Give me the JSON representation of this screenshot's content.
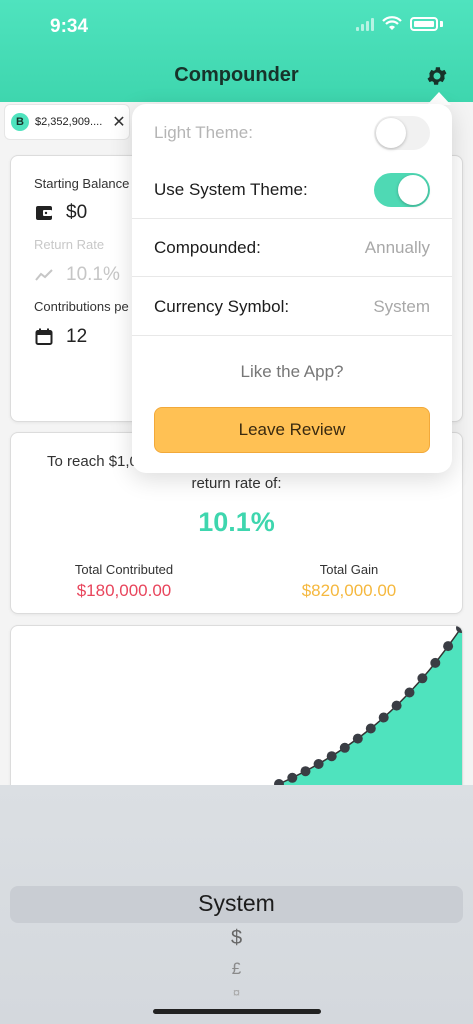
{
  "status_bar": {
    "time": "9:34"
  },
  "header": {
    "title": "Compounder"
  },
  "tabs": [
    {
      "badge": "B",
      "label": "$2,352,909...."
    }
  ],
  "calculator": {
    "starting_balance_label": "Starting Balance",
    "starting_balance_value": "$0",
    "return_rate_label": "Return Rate",
    "return_rate_value": "10.1%",
    "contributions_label": "Contributions pe",
    "contributions_value": "12"
  },
  "result": {
    "reach_text": "To reach $1,0",
    "return_rate_text": "return rate of:",
    "rate": "10.1%",
    "total_contributed_label": "Total Contributed",
    "total_contributed_value": "$180,000.00",
    "total_gain_label": "Total Gain",
    "total_gain_value": "$820,000.00"
  },
  "settings_popover": {
    "light_theme_label": "Light Theme:",
    "light_theme_on": false,
    "system_theme_label": "Use System Theme:",
    "system_theme_on": true,
    "compounded_label": "Compounded:",
    "compounded_value": "Annually",
    "currency_label": "Currency Symbol:",
    "currency_value": "System",
    "like_text": "Like the App?",
    "review_button": "Leave Review"
  },
  "picker": {
    "selected": "System",
    "options": [
      "$",
      "£",
      "¤"
    ]
  },
  "colors": {
    "accent": "#3ed6ae",
    "contributed": "#e8455c",
    "gain": "#f5b83e",
    "review": "#ffc154"
  },
  "icons": [
    "gear-icon",
    "wallet-icon",
    "trend-icon",
    "calendar-icon",
    "close-icon"
  ]
}
